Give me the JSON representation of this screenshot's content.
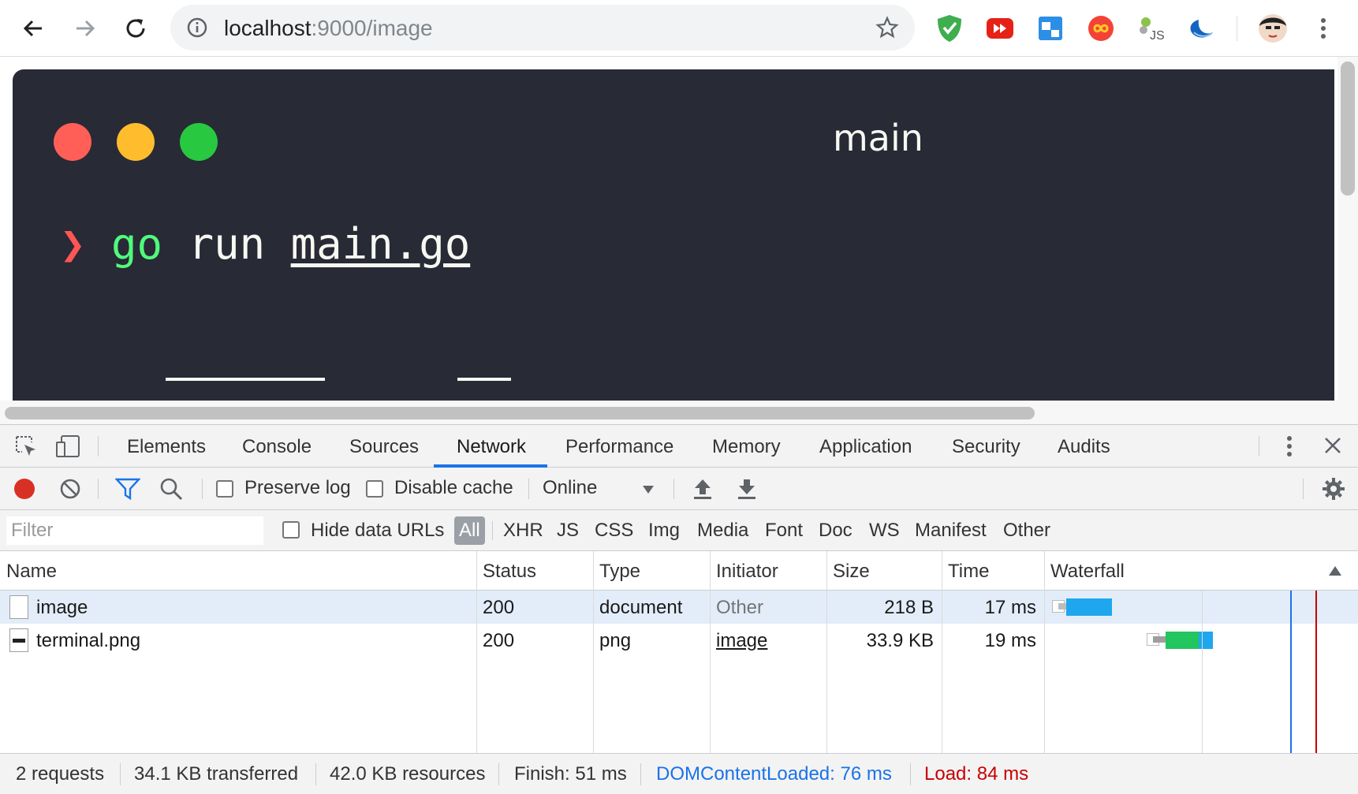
{
  "browser": {
    "url_host": "localhost",
    "url_rest": ":9000/image"
  },
  "page": {
    "terminal_title": "main",
    "prompt_symbol": "❯",
    "command": "go",
    "arg": "run",
    "file": "main.go"
  },
  "devtools": {
    "tabs": [
      "Elements",
      "Console",
      "Sources",
      "Network",
      "Performance",
      "Memory",
      "Application",
      "Security",
      "Audits"
    ],
    "active_tab": "Network",
    "toolbar": {
      "preserve_log": "Preserve log",
      "disable_cache": "Disable cache",
      "throttle": "Online"
    },
    "filter": {
      "placeholder": "Filter",
      "hide_data_urls": "Hide data URLs",
      "types": [
        "All",
        "XHR",
        "JS",
        "CSS",
        "Img",
        "Media",
        "Font",
        "Doc",
        "WS",
        "Manifest",
        "Other"
      ]
    },
    "columns": [
      "Name",
      "Status",
      "Type",
      "Initiator",
      "Size",
      "Time",
      "Waterfall"
    ],
    "rows": [
      {
        "name": "image",
        "status": "200",
        "type": "document",
        "initiator": "Other",
        "size": "218 B",
        "time": "17 ms"
      },
      {
        "name": "terminal.png",
        "status": "200",
        "type": "png",
        "initiator": "image",
        "size": "33.9 KB",
        "time": "19 ms"
      }
    ],
    "status": {
      "requests": "2 requests",
      "transferred": "34.1 KB transferred",
      "resources": "42.0 KB resources",
      "finish": "Finish: 51 ms",
      "dcl": "DOMContentLoaded: 76 ms",
      "load": "Load: 84 ms"
    }
  },
  "colors": {
    "terminal_bg": "#282a36",
    "red_light": "#ff5f57",
    "yellow_light": "#ffbd2e",
    "green_light": "#28c940",
    "accent": "#1a73e8",
    "dcl_color": "#1a73e8",
    "load_color": "#c80000"
  }
}
